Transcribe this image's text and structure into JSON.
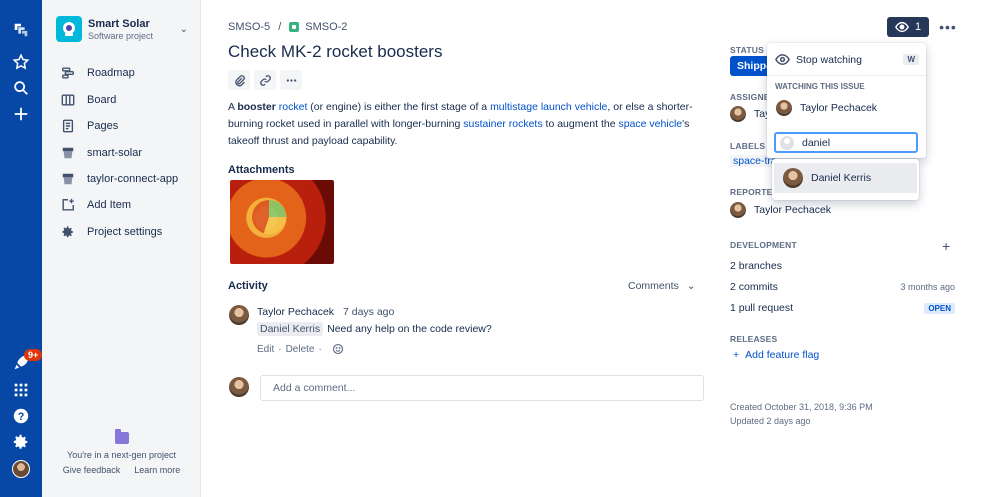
{
  "global_nav": {
    "icons": [
      "jira-logo-icon",
      "star-icon",
      "search-icon",
      "plus-icon",
      "rocket-icon",
      "apps-grid-icon",
      "help-icon",
      "settings-icon"
    ],
    "notification_count": "9+",
    "bg_color": "#0747A6"
  },
  "project": {
    "name": "Smart Solar",
    "type": "Software project"
  },
  "sidebar": {
    "items": [
      {
        "label": "Roadmap",
        "icon": "roadmap-icon"
      },
      {
        "label": "Board",
        "icon": "board-icon"
      },
      {
        "label": "Pages",
        "icon": "pages-icon"
      },
      {
        "label": "smart-solar",
        "icon": "repo-icon"
      },
      {
        "label": "taylor-connect-app",
        "icon": "repo-icon"
      },
      {
        "label": "Add Item",
        "icon": "add-item-icon"
      },
      {
        "label": "Project settings",
        "icon": "gear-icon"
      }
    ],
    "nextgen_text": "You're in a next-gen project",
    "give_feedback": "Give feedback",
    "learn_more": "Learn more"
  },
  "breadcrumb": {
    "parent": "SMSO-5",
    "separator": "/",
    "current": "SMSO-2"
  },
  "issue": {
    "title": "Check MK-2 rocket boosters",
    "description": {
      "p1": "A ",
      "b1": "booster",
      "p2": " ",
      "l1": "rocket",
      "p3": " (or engine) is either the first stage of a ",
      "l2": "multistage launch vehicle",
      "p4": ", or else a shorter-burning rocket used in parallel with longer-burning ",
      "l3": "sustainer rockets",
      "p5": " to augment the ",
      "l4": "space vehicle",
      "p6": "'s takeoff thrust and payload capability."
    }
  },
  "attachments": {
    "heading": "Attachments"
  },
  "activity": {
    "heading": "Activity",
    "filter": "Comments",
    "comment": {
      "author": "Taylor Pechacek",
      "time": "7 days ago",
      "mention": "Daniel Kerris",
      "text": "Need any help on the code review?",
      "edit": "Edit",
      "delete": "Delete",
      "dot": "·"
    },
    "new_comment_placeholder": "Add a comment..."
  },
  "right": {
    "watch_count": "1",
    "status_label": "STATUS",
    "status_value": "Shipped",
    "assignee_label": "ASSIGNEE",
    "assignee_name": "Taylor Pechacek",
    "labels_label": "LABELS",
    "label_value": "space-tra",
    "reporter_label": "REPORTER",
    "reporter_name": "Taylor Pechacek",
    "development_label": "DEVELOPMENT",
    "branches": "2 branches",
    "commits": "2 commits",
    "commits_time": "3 months ago",
    "pull_request": "1 pull request",
    "pr_status": "OPEN",
    "releases_label": "RELEASES",
    "add_flag": "Add feature flag",
    "created": "Created October 31, 2018, 9:36 PM",
    "updated": "Updated 2 days ago"
  },
  "watch_dropdown": {
    "stop_watching": "Stop watching",
    "shortcut": "W",
    "watching_heading": "WATCHING THIS ISSUE",
    "watcher": "Taylor Pechacek",
    "search_value": "daniel",
    "suggestion": "Daniel Kerris"
  }
}
